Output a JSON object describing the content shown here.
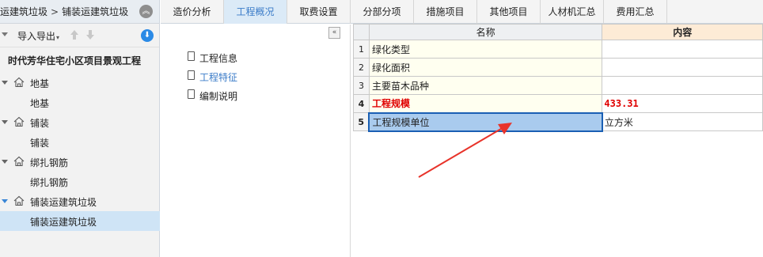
{
  "breadcrumb": {
    "parent": "运建筑垃圾",
    "separator": ">",
    "current": "铺装运建筑垃圾"
  },
  "toolbar": {
    "import_export": "导入导出"
  },
  "tree": {
    "root": "时代芳华住宅小区项目景观工程",
    "groups": [
      {
        "label": "地基",
        "child": "地基"
      },
      {
        "label": "铺装",
        "child": "铺装"
      },
      {
        "label": "绑扎钢筋",
        "child": "绑扎钢筋"
      },
      {
        "label": "铺装运建筑垃圾",
        "child": "铺装运建筑垃圾"
      }
    ]
  },
  "tabs": [
    "造价分析",
    "工程概况",
    "取费设置",
    "分部分项",
    "措施项目",
    "其他项目",
    "人材机汇总",
    "费用汇总"
  ],
  "active_tab": "工程概况",
  "middle": {
    "items": [
      "工程信息",
      "工程特征",
      "编制说明"
    ],
    "active_item": "工程特征"
  },
  "grid": {
    "headers": {
      "name": "名称",
      "content": "内容"
    },
    "rows": [
      {
        "num": "1",
        "name": "绿化类型",
        "value": ""
      },
      {
        "num": "2",
        "name": "绿化面积",
        "value": ""
      },
      {
        "num": "3",
        "name": "主要苗木品种",
        "value": ""
      },
      {
        "num": "4",
        "name": "工程规模",
        "value": "433.31"
      },
      {
        "num": "5",
        "name": "工程规模单位",
        "value": "立方米"
      }
    ]
  },
  "colors": {
    "accent": "#3a7bc8",
    "highlight_red": "#e00000",
    "selection": "#a9cbee",
    "arrow": "#e8332a"
  }
}
